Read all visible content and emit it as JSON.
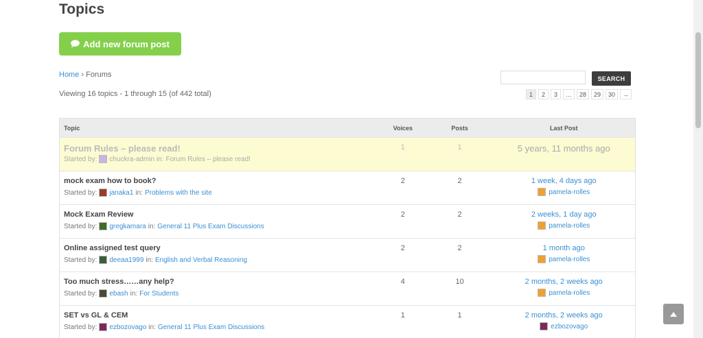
{
  "page": {
    "title": "Topics"
  },
  "add_button": {
    "label": "Add new forum post",
    "icon": "comment-icon",
    "color": "#84d04b"
  },
  "breadcrumb": {
    "home": "Home",
    "sep": "›",
    "current": "Forums"
  },
  "count_text": "Viewing 16 topics - 1 through 15 (of 442 total)",
  "search": {
    "button_label": "SEARCH",
    "value": ""
  },
  "pagination": {
    "pages": [
      "1",
      "2",
      "3",
      "…",
      "28",
      "29",
      "30",
      "→"
    ],
    "current": "1"
  },
  "table": {
    "headers": {
      "topic": "Topic",
      "voices": "Voices",
      "posts": "Posts",
      "last_post": "Last Post"
    },
    "started_by_label": "Started by:",
    "in_label": "in:",
    "rows": [
      {
        "title": "Forum Rules – please read!",
        "author": "chuckra-admin",
        "forum": "Forum Rules – please read!",
        "voices": "1",
        "posts": "1",
        "freshness": "5 years, 11 months ago",
        "last_author": "",
        "sticky": true,
        "avatar_color": "#c8b3e6",
        "last_avatar_color": ""
      },
      {
        "title": "mock exam how to book?",
        "author": "janaka1",
        "forum": "Problems with the site",
        "voices": "2",
        "posts": "2",
        "freshness": "1 week, 4 days ago",
        "last_author": "pamela-rolles",
        "avatar_color": "#9a3b2c",
        "last_avatar_color": "#f0a030"
      },
      {
        "title": "Mock Exam Review",
        "author": "gregkamara",
        "forum": "General 11 Plus Exam Discussions",
        "voices": "2",
        "posts": "2",
        "freshness": "2 weeks, 1 day ago",
        "last_author": "pamela-rolles",
        "avatar_color": "#3e6a2a",
        "last_avatar_color": "#f0a030"
      },
      {
        "title": "Online assigned test query",
        "author": "deeaa1999",
        "forum": "English and Verbal Reasoning",
        "voices": "2",
        "posts": "2",
        "freshness": "1 month ago",
        "last_author": "pamela-rolles",
        "avatar_color": "#3a5e3a",
        "last_avatar_color": "#f0a030"
      },
      {
        "title": "Too much stress……any help?",
        "author": "ebash",
        "forum": "For Students",
        "voices": "4",
        "posts": "10",
        "freshness": "2 months, 2 weeks ago",
        "last_author": "pamela-rolles",
        "avatar_color": "#4a4a3a",
        "last_avatar_color": "#f0a030"
      },
      {
        "title": "SET vs GL & CEM",
        "author": "ezbozovago",
        "forum": "General 11 Plus Exam Discussions",
        "voices": "1",
        "posts": "1",
        "freshness": "2 months, 2 weeks ago",
        "last_author": "ezbozovago",
        "avatar_color": "#7a2a5a",
        "last_avatar_color": "#7a2a5a"
      }
    ]
  }
}
